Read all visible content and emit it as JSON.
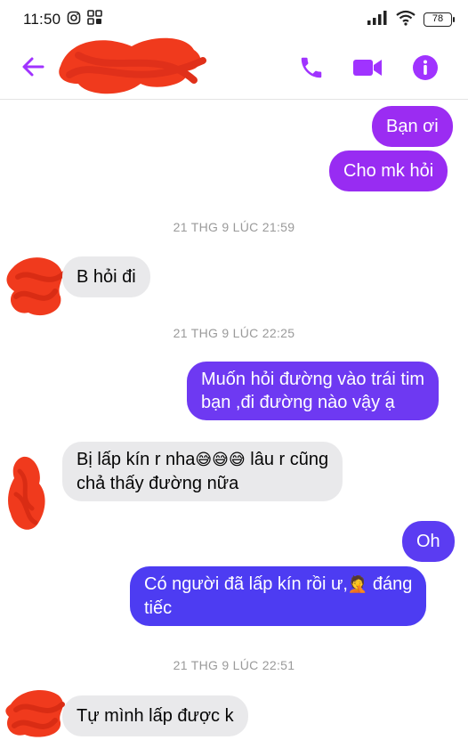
{
  "status_bar": {
    "time": "11:50",
    "battery": "78"
  },
  "header": {
    "contact_name": ""
  },
  "colors": {
    "accent": "#a033ff",
    "outgoing_top": "#9b2cf2",
    "outgoing_bottom": "#4d3cf2",
    "incoming": "#e9e9eb",
    "redaction": "#f03a1d"
  },
  "messages": [
    {
      "dir": "out",
      "text": "Bạn ơi"
    },
    {
      "dir": "out",
      "text": "Cho mk hỏi"
    },
    {
      "dir": "time",
      "text": "21 THG 9 LÚC 21:59"
    },
    {
      "dir": "in",
      "text": "B hỏi đi"
    },
    {
      "dir": "time",
      "text": "21 THG 9 LÚC 22:25"
    },
    {
      "dir": "out",
      "line1": "Muốn hỏi đường vào trái tim",
      "line2": "bạn ,đi đường nào vậy ạ"
    },
    {
      "dir": "in",
      "line1_a": "Bị lấp kín r nha",
      "line1_emoji": "😅😅😅",
      "line1_b": " lâu r cũng",
      "line2": "chả thấy đường nữa"
    },
    {
      "dir": "out",
      "text": "Oh"
    },
    {
      "dir": "out",
      "line1_a": "Có người đã lấp kín rồi ư,",
      "line1_emoji": "🤦",
      "line1_b": " đáng",
      "line2": "tiếc"
    },
    {
      "dir": "time",
      "text": "21 THG 9 LÚC 22:51"
    },
    {
      "dir": "in",
      "text": "Tự mình lấp được k"
    }
  ]
}
